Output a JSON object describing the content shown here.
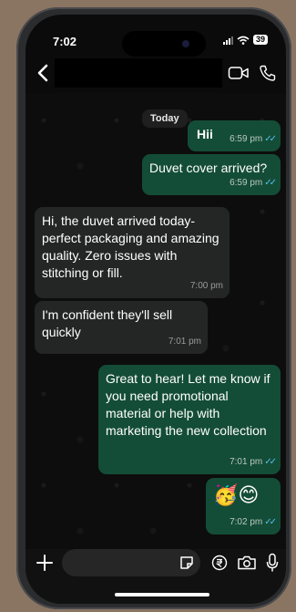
{
  "status": {
    "time": "7:02",
    "battery": "39"
  },
  "chat": {
    "date_label": "Today"
  },
  "messages": [
    {
      "dir": "out",
      "text": "Hii",
      "time": "6:59 pm"
    },
    {
      "dir": "out",
      "text": "Duvet cover arrived?",
      "time": "6:59 pm"
    },
    {
      "dir": "in",
      "text": "Hi, the duvet arrived today-perfect packaging and amazing quality. Zero issues with stitching or fill.",
      "time": "7:00 pm"
    },
    {
      "dir": "in",
      "text": "I'm confident they'll sell quickly",
      "time": "7:01 pm"
    },
    {
      "dir": "out",
      "text": "Great to hear! Let me know if you need promotional material or help with marketing the new collection",
      "time": "7:01 pm"
    },
    {
      "dir": "out",
      "text": "🥳😊",
      "time": "7:02 pm"
    }
  ],
  "icons": [
    "back-arrow-icon",
    "video-call-icon",
    "phone-call-icon",
    "plus-icon",
    "sticker-icon",
    "rupee-icon",
    "camera-icon",
    "mic-icon"
  ],
  "colors": {
    "outgoing_bubble": "#144d37",
    "incoming_bubble": "#242626",
    "read_ticks": "#53bdeb"
  }
}
